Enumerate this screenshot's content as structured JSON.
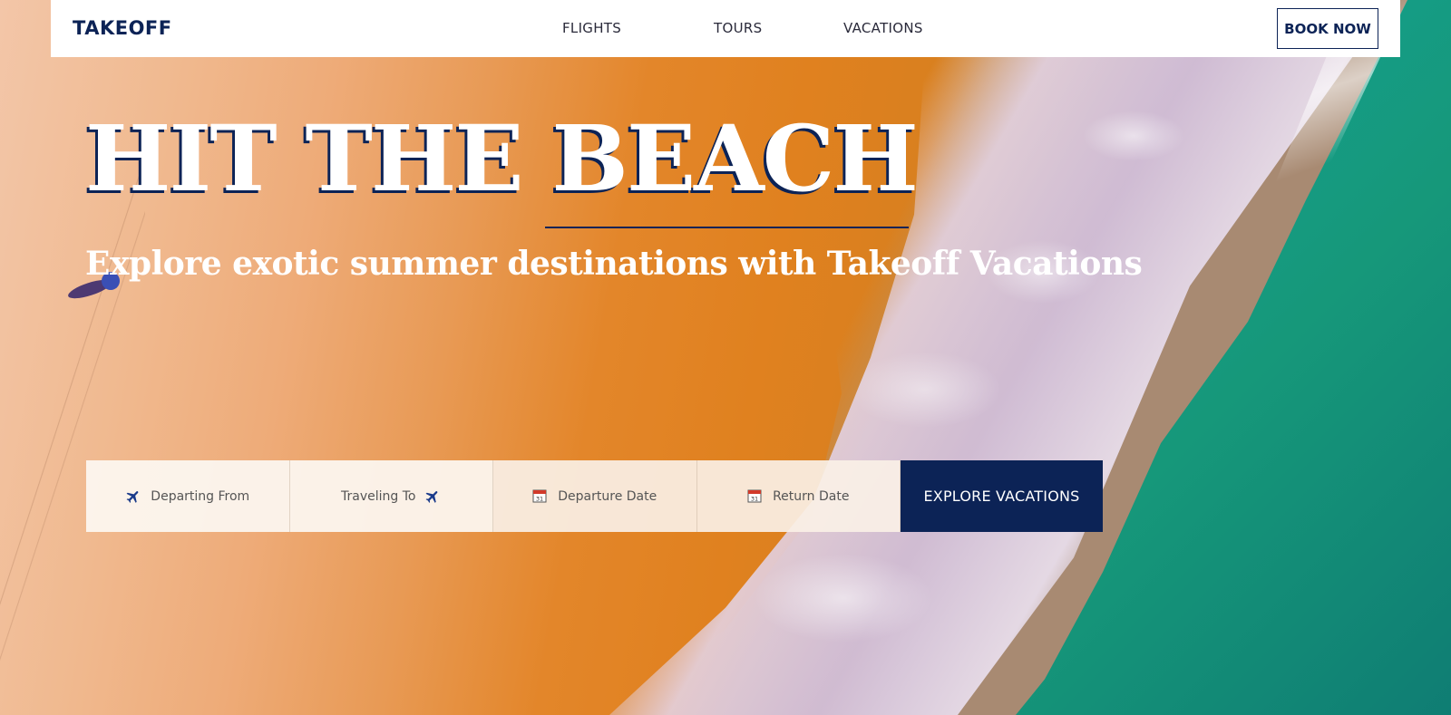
{
  "nav": {
    "brand": "TAKEOFF",
    "links": [
      "FLIGHTS",
      "TOURS",
      "VACATIONS"
    ],
    "cta": "BOOK NOW"
  },
  "hero": {
    "title": "HIT THE BEACH",
    "subtitle": "Explore exotic summer destinations with Takeoff Vacations"
  },
  "search": {
    "fields": [
      {
        "label": "Departing From",
        "icon": "plane-icon"
      },
      {
        "label": "Traveling To",
        "icon": "plane-icon"
      },
      {
        "label": "Departure Date",
        "icon": "calendar-icon"
      },
      {
        "label": "Return Date",
        "icon": "calendar-icon"
      }
    ],
    "submit": "EXPLORE VACATIONS"
  },
  "colors": {
    "brand": "#0c2356",
    "white": "#ffffff"
  }
}
